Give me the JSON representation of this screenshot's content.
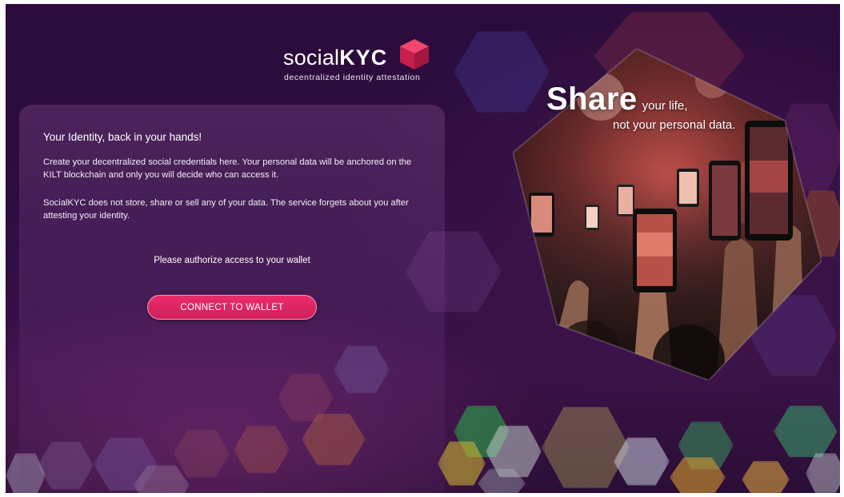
{
  "logo": {
    "word_thin": "social",
    "word_bold": "KYC",
    "tagline": "decentralized identity attestation",
    "cube_colors": {
      "top": "#f0466f",
      "left": "#c81e4d",
      "right": "#a3163f"
    }
  },
  "card": {
    "title": "Your Identity, back in your hands!",
    "paragraph_1": "Create your decentralized social credentials here. Your personal data will be anchored on the KILT blockchain and only you will decide who can access it.",
    "paragraph_2": "SocialKYC does not store, share or sell any of your data. The service forgets about you after attesting your identity.",
    "authorize_prompt": "Please authorize access to your wallet",
    "connect_button": "CONNECT TO WALLET"
  },
  "hero": {
    "headline_big": "Share",
    "headline_rest": "your life,",
    "headline_line2": "not your personal data."
  },
  "colors": {
    "background": "#2d0d3f",
    "accent": "#e3286a",
    "text": "#ffffff"
  }
}
